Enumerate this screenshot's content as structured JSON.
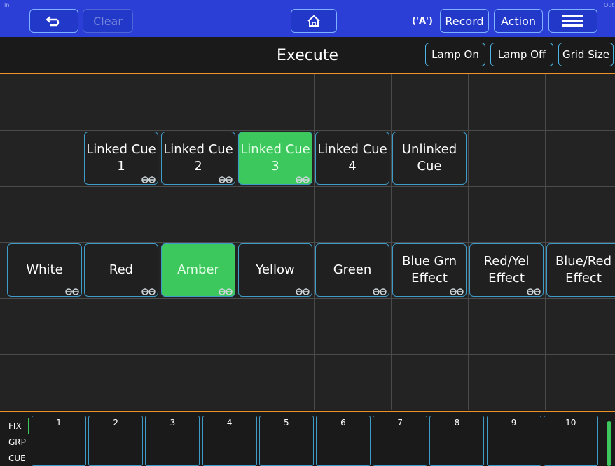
{
  "topbar": {
    "corner_in": "In",
    "corner_out": "Out",
    "back_label": "⮌",
    "clear_label": "Clear",
    "home_label": "⌂",
    "wireless_label": "('A')",
    "record_label": "Record",
    "action_label": "Action",
    "menu_label": "☰"
  },
  "header": {
    "title": "Execute",
    "lamp_on_label": "Lamp On",
    "lamp_off_label": "Lamp Off",
    "grid_size_label": "Grid Size"
  },
  "cues_row1": [
    {
      "label": "Linked Cue\n1",
      "active": false,
      "linked": true
    },
    {
      "label": "Linked Cue\n2",
      "active": false,
      "linked": true
    },
    {
      "label": "Linked Cue\n3",
      "active": true,
      "linked": true
    },
    {
      "label": "Linked Cue\n4",
      "active": false,
      "linked": false
    },
    {
      "label": "Unlinked\nCue",
      "active": false,
      "linked": false
    }
  ],
  "cues_row2": [
    {
      "label": "White",
      "active": false,
      "linked": true
    },
    {
      "label": "Red",
      "active": false,
      "linked": true
    },
    {
      "label": "Amber",
      "active": true,
      "linked": true
    },
    {
      "label": "Yellow",
      "active": false,
      "linked": true
    },
    {
      "label": "Green",
      "active": false,
      "linked": true
    },
    {
      "label": "Blue Grn\nEffect",
      "active": false,
      "linked": true
    },
    {
      "label": "Red/Yel\nEffect",
      "active": false,
      "linked": true
    },
    {
      "label": "Blue/Red\nEffect",
      "active": false,
      "linked": false
    }
  ],
  "bottom": {
    "tabs": [
      "FIX",
      "GRP",
      "CUE"
    ],
    "faders": [
      "1",
      "2",
      "3",
      "4",
      "5",
      "6",
      "7",
      "8",
      "9",
      "10"
    ]
  },
  "colors": {
    "topbar": "#2b3fd6",
    "accent_orange": "#f0922a",
    "active_green": "#3dc85e",
    "border_blue": "#3f9cc8"
  }
}
